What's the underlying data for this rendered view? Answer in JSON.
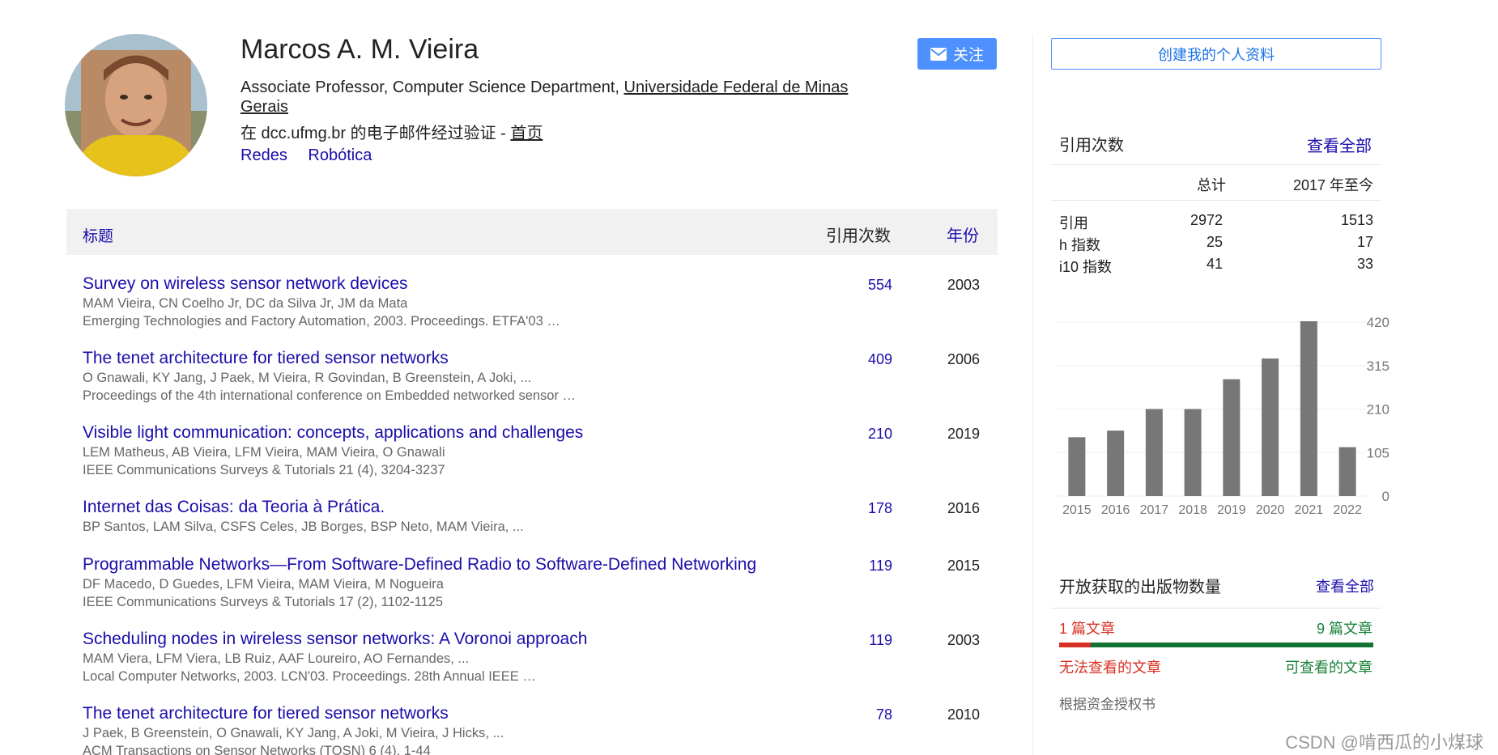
{
  "profile": {
    "name": "Marcos A. M. Vieira",
    "affiliation_prefix": "Associate Professor, Computer Science Department, ",
    "affiliation_org": "Universidade Federal de Minas Gerais",
    "verified_text": "在 dcc.ufmg.br 的电子邮件经过验证 - ",
    "homepage_label": "首页",
    "interests": [
      "Redes",
      "Robótica"
    ],
    "follow_label": "关注"
  },
  "table": {
    "col_title": "标题",
    "col_cites": "引用次数",
    "col_year": "年份",
    "rows": [
      {
        "title": "Survey on wireless sensor network devices",
        "authors": "MAM Vieira, CN Coelho Jr, DC da Silva Jr, JM da Mata",
        "venue": "Emerging Technologies and Factory Automation, 2003. Proceedings. ETFA'03 …",
        "cites": "554",
        "year": "2003"
      },
      {
        "title": "The tenet architecture for tiered sensor networks",
        "authors": "O Gnawali, KY Jang, J Paek, M Vieira, R Govindan, B Greenstein, A Joki, ...",
        "venue": "Proceedings of the 4th international conference on Embedded networked sensor …",
        "cites": "409",
        "year": "2006"
      },
      {
        "title": "Visible light communication: concepts, applications and challenges",
        "authors": "LEM Matheus, AB Vieira, LFM Vieira, MAM Vieira, O Gnawali",
        "venue": "IEEE Communications Surveys & Tutorials 21 (4), 3204-3237",
        "cites": "210",
        "year": "2019"
      },
      {
        "title": "Internet das Coisas: da Teoria à Prática.",
        "authors": "BP Santos, LAM Silva, CSFS Celes, JB Borges, BSP Neto, MAM Vieira, ...",
        "venue": "",
        "cites": "178",
        "year": "2016"
      },
      {
        "title": "Programmable Networks—From Software-Defined Radio to Software-Defined Networking",
        "authors": "DF Macedo, D Guedes, LFM Vieira, MAM Vieira, M Nogueira",
        "venue": "IEEE Communications Surveys & Tutorials 17 (2), 1102-1125",
        "cites": "119",
        "year": "2015"
      },
      {
        "title": "Scheduling nodes in wireless sensor networks: A Voronoi approach",
        "authors": "MAM Viera, LFM Viera, LB Ruiz, AAF Loureiro, AO Fernandes, ...",
        "venue": "Local Computer Networks, 2003. LCN'03. Proceedings. 28th Annual IEEE …",
        "cites": "119",
        "year": "2003"
      },
      {
        "title": "The tenet architecture for tiered sensor networks",
        "authors": "J Paek, B Greenstein, O Gnawali, KY Jang, A Joki, M Vieira, J Hicks, ...",
        "venue": "ACM Transactions on Sensor Networks (TOSN) 6 (4), 1-44",
        "cites": "78",
        "year": "2010"
      }
    ]
  },
  "sidebar": {
    "create_profile_label": "创建我的个人资料",
    "citations_title": "引用次数",
    "view_all_label": "查看全部",
    "header_total": "总计",
    "header_since": "2017 年至今",
    "metrics": [
      {
        "label": "引用",
        "total": "2972",
        "since": "1513"
      },
      {
        "label": "h 指数",
        "total": "25",
        "since": "17"
      },
      {
        "label": "i10 指数",
        "total": "41",
        "since": "33"
      }
    ],
    "open_access_title": "开放获取的出版物数量",
    "open_access_view_all": "查看全部",
    "not_available_count": "1 篇文章",
    "available_count": "9 篇文章",
    "not_available_label": "无法查看的文章",
    "available_label": "可查看的文章",
    "not_available_fraction": 0.1,
    "mandates_label": "根据资金授权书"
  },
  "chart_data": {
    "type": "bar",
    "categories": [
      "2015",
      "2016",
      "2017",
      "2018",
      "2019",
      "2020",
      "2021",
      "2022"
    ],
    "values": [
      142,
      158,
      210,
      210,
      282,
      332,
      422,
      118
    ],
    "yticks": [
      "420",
      "315",
      "210",
      "105",
      "0"
    ],
    "ylim": [
      0,
      420
    ],
    "bar_color": "#777777"
  },
  "watermark": "CSDN @啃西瓜的小煤球"
}
